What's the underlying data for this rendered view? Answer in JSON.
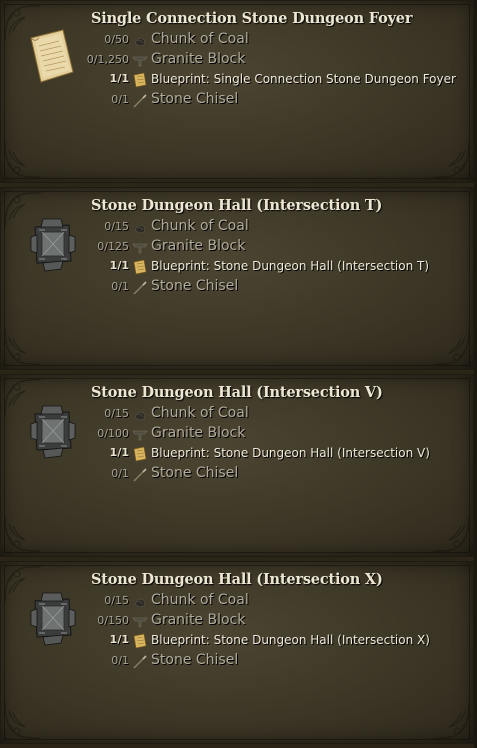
{
  "recipes": [
    {
      "title": "Single Connection Stone Dungeon Foyer",
      "icon": "parchment-blueprint-icon",
      "ingredients": [
        {
          "qty": "0/50",
          "name": "Chunk of Coal",
          "icon": "coal-icon"
        },
        {
          "qty": "0/1,250",
          "name": "Granite Block",
          "icon": "granite-block-icon"
        },
        {
          "qty": "1/1",
          "name": "Blueprint: Single Connection Stone Dungeon Foyer",
          "icon": "blueprint-icon"
        },
        {
          "qty": "0/1",
          "name": "Stone Chisel",
          "icon": "chisel-icon"
        }
      ]
    },
    {
      "title": "Stone Dungeon Hall (Intersection T)",
      "icon": "stone-hall-icon",
      "ingredients": [
        {
          "qty": "0/15",
          "name": "Chunk of Coal",
          "icon": "coal-icon"
        },
        {
          "qty": "0/125",
          "name": "Granite Block",
          "icon": "granite-block-icon"
        },
        {
          "qty": "1/1",
          "name": "Blueprint: Stone Dungeon Hall (Intersection T)",
          "icon": "blueprint-icon"
        },
        {
          "qty": "0/1",
          "name": "Stone Chisel",
          "icon": "chisel-icon"
        }
      ]
    },
    {
      "title": "Stone Dungeon Hall (Intersection V)",
      "icon": "stone-hall-icon",
      "ingredients": [
        {
          "qty": "0/15",
          "name": "Chunk of Coal",
          "icon": "coal-icon"
        },
        {
          "qty": "0/100",
          "name": "Granite Block",
          "icon": "granite-block-icon"
        },
        {
          "qty": "1/1",
          "name": "Blueprint: Stone Dungeon Hall (Intersection V)",
          "icon": "blueprint-icon"
        },
        {
          "qty": "0/1",
          "name": "Stone Chisel",
          "icon": "chisel-icon"
        }
      ]
    },
    {
      "title": "Stone Dungeon Hall (Intersection X)",
      "icon": "stone-hall-icon",
      "ingredients": [
        {
          "qty": "0/15",
          "name": "Chunk of Coal",
          "icon": "coal-icon"
        },
        {
          "qty": "0/150",
          "name": "Granite Block",
          "icon": "granite-block-icon"
        },
        {
          "qty": "1/1",
          "name": "Blueprint: Stone Dungeon Hall (Intersection X)",
          "icon": "blueprint-icon"
        },
        {
          "qty": "0/1",
          "name": "Stone Chisel",
          "icon": "chisel-icon"
        }
      ]
    }
  ],
  "colors": {
    "panel_bg": "#3f3928",
    "title_text": "#ece6d2",
    "ingredient_text": "#b1ab9b",
    "have_text": "#f0ead8"
  }
}
